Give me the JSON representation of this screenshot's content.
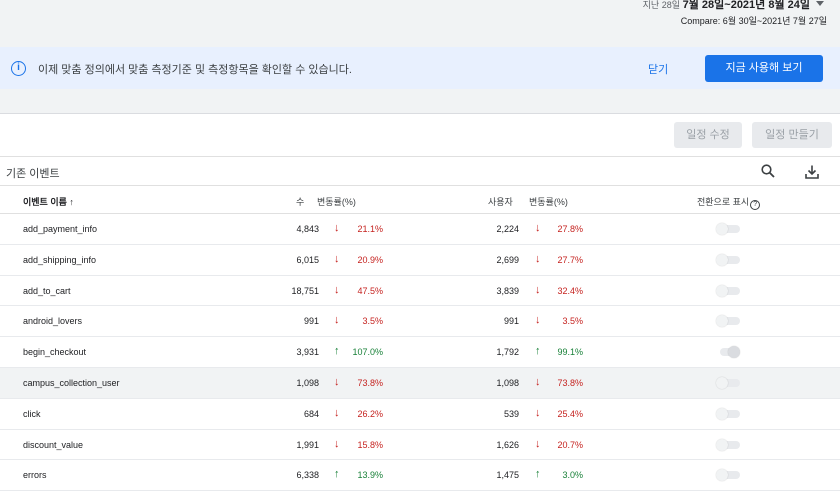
{
  "date_range": {
    "prefix": "지난 28일",
    "main": "7월 28일~2021년 8월 24일",
    "compare": "Compare: 6월 30일~2021년 7월 27일"
  },
  "banner": {
    "icon": "info-icon",
    "text": "이제 맞춤 정의에서 맞춤 측정기준 및 측정항목을 확인할 수 있습니다.",
    "close": "닫기",
    "cta": "지금 사용해 보기"
  },
  "toolbar": {
    "edit": "일정 수정",
    "create": "일정 만들기"
  },
  "section": {
    "title": "기존 이벤트"
  },
  "table": {
    "headers": {
      "name": "이벤트 이름",
      "sort_arrow": "↑",
      "count": "수",
      "change1": "변동률(%)",
      "users": "사용자",
      "change2": "변동률(%)",
      "conversion": "전환으로 표시",
      "help": "?"
    },
    "rows": [
      {
        "name": "add_payment_info",
        "count": "4,843",
        "dir1": "↓",
        "pct1": "21.1%",
        "users": "2,224",
        "dir2": "↓",
        "pct2": "27.8%",
        "conversion": "off"
      },
      {
        "name": "add_shipping_info",
        "count": "6,015",
        "dir1": "↓",
        "pct1": "20.9%",
        "users": "2,699",
        "dir2": "↓",
        "pct2": "27.7%",
        "conversion": "off"
      },
      {
        "name": "add_to_cart",
        "count": "18,751",
        "dir1": "↓",
        "pct1": "47.5%",
        "users": "3,839",
        "dir2": "↓",
        "pct2": "32.4%",
        "conversion": "off"
      },
      {
        "name": "android_lovers",
        "count": "991",
        "dir1": "↓",
        "pct1": "3.5%",
        "users": "991",
        "dir2": "↓",
        "pct2": "3.5%",
        "conversion": "off"
      },
      {
        "name": "begin_checkout",
        "count": "3,931",
        "dir1": "↑",
        "pct1": "107.0%",
        "users": "1,792",
        "dir2": "↑",
        "pct2": "99.1%",
        "conversion": "on"
      },
      {
        "name": "campus_collection_user",
        "count": "1,098",
        "dir1": "↓",
        "pct1": "73.8%",
        "users": "1,098",
        "dir2": "↓",
        "pct2": "73.8%",
        "conversion": "off"
      },
      {
        "name": "click",
        "count": "684",
        "dir1": "↓",
        "pct1": "26.2%",
        "users": "539",
        "dir2": "↓",
        "pct2": "25.4%",
        "conversion": "off"
      },
      {
        "name": "discount_value",
        "count": "1,991",
        "dir1": "↓",
        "pct1": "15.8%",
        "users": "1,626",
        "dir2": "↓",
        "pct2": "20.7%",
        "conversion": "off"
      },
      {
        "name": "errors",
        "count": "6,338",
        "dir1": "↑",
        "pct1": "13.9%",
        "users": "1,475",
        "dir2": "↑",
        "pct2": "3.0%",
        "conversion": "off"
      }
    ]
  },
  "highlighted_row": 5,
  "colors": {
    "accent": "#1a73e8",
    "down": "#c5221f",
    "up": "#188038"
  }
}
